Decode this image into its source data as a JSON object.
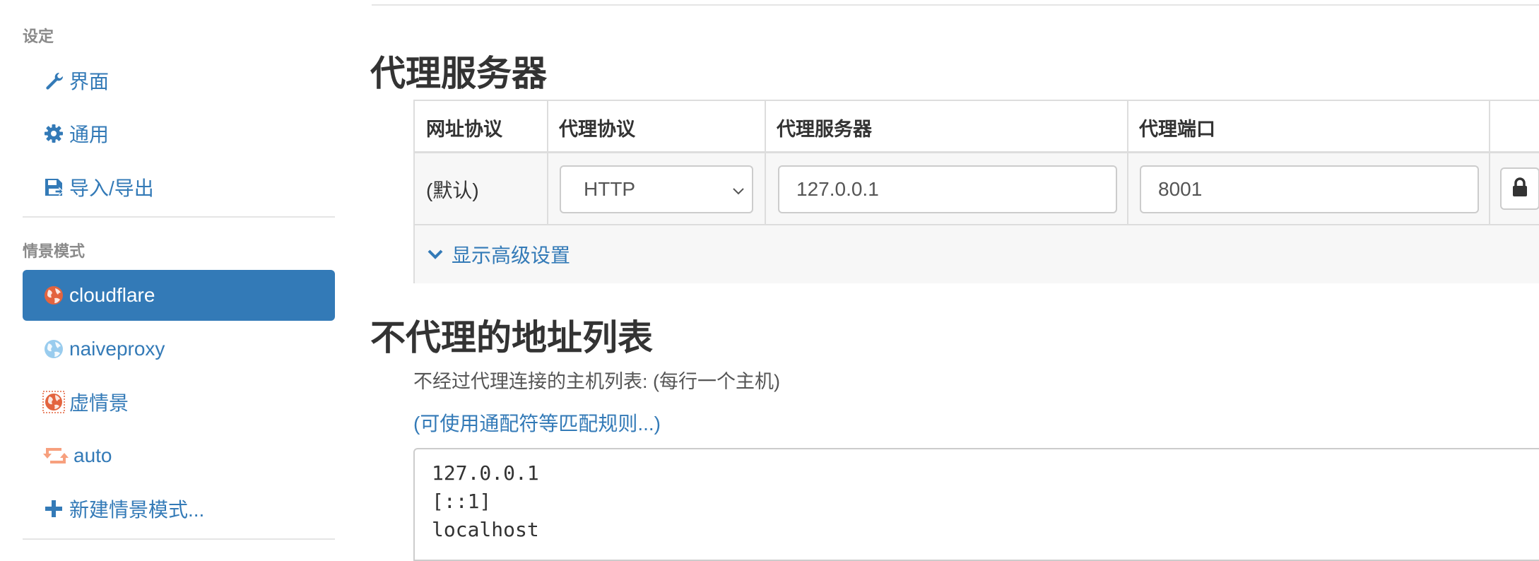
{
  "sidebar": {
    "settings_header": "设定",
    "settings_items": [
      {
        "label": "界面",
        "icon": "wrench-icon"
      },
      {
        "label": "通用",
        "icon": "gear-icon"
      },
      {
        "label": "导入/导出",
        "icon": "floppy-disk-icon"
      }
    ],
    "profiles_header": "情景模式",
    "profiles": [
      {
        "label": "cloudflare",
        "icon": "globe-icon",
        "color": "#e3643f",
        "active": true
      },
      {
        "label": "naiveproxy",
        "icon": "globe-icon",
        "color": "#99ccee",
        "active": false
      },
      {
        "label": "虚情景",
        "icon": "virtual-globe-icon",
        "color": "#e3643f",
        "active": false
      },
      {
        "label": "auto",
        "icon": "retweet-icon",
        "color": "#f7a07e",
        "active": false
      }
    ],
    "new_profile_label": "新建情景模式..."
  },
  "main": {
    "proxy_title": "代理服务器",
    "table": {
      "headers": [
        "网址协议",
        "代理协议",
        "代理服务器",
        "代理端口"
      ],
      "row": {
        "scheme": "(默认)",
        "protocol": "HTTP",
        "server": "127.0.0.1",
        "port": "8001"
      },
      "advanced_label": "显示高级设置"
    },
    "bypass_title": "不代理的地址列表",
    "bypass_help": "不经过代理连接的主机列表: (每行一个主机)",
    "wildcard_link": "(可使用通配符等匹配规则...)",
    "bypass_list": [
      "127.0.0.1",
      "[::1]",
      "localhost"
    ]
  },
  "colors": {
    "accent": "#337ab7",
    "text": "#333333",
    "muted": "#8a8a8a",
    "border": "#dddddd"
  }
}
